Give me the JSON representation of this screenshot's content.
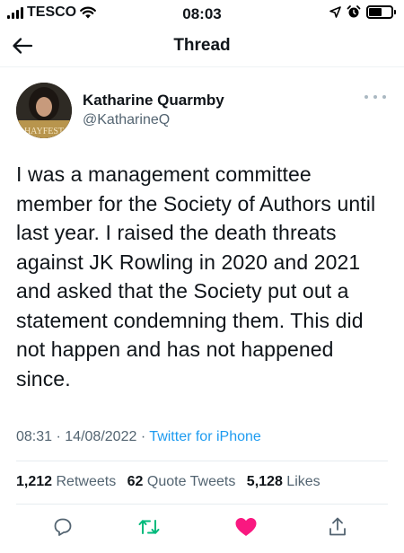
{
  "status_bar": {
    "carrier": "TESCO",
    "time": "08:03"
  },
  "nav": {
    "title": "Thread"
  },
  "tweet": {
    "author_name": "Katharine Quarmby",
    "author_handle": "@KatharineQ",
    "avatar_caption": "HAYFEST",
    "text": "I was a management committee member for the Society of Authors until last year. I raised the death threats against JK Rowling in 2020 and 2021 and asked that the Society put out a statement condemning them. This did not happen and has not happened since.",
    "time": "08:31",
    "separator": "·",
    "date": "14/08/2022",
    "source": "Twitter for iPhone",
    "stats": {
      "retweets_count": "1,212",
      "retweets_label": "Retweets",
      "quotes_count": "62",
      "quotes_label": "Quote Tweets",
      "likes_count": "5,128",
      "likes_label": "Likes"
    },
    "liked": true
  },
  "icons": {
    "back": "arrow-left-icon",
    "more": "more-dots-icon",
    "reply": "reply-icon",
    "retweet": "retweet-icon",
    "like": "heart-icon",
    "share": "share-icon"
  },
  "colors": {
    "accent": "#1d9bf0",
    "retweet_green": "#00ba7c",
    "like_pink": "#f91880",
    "secondary_text": "#536471"
  }
}
